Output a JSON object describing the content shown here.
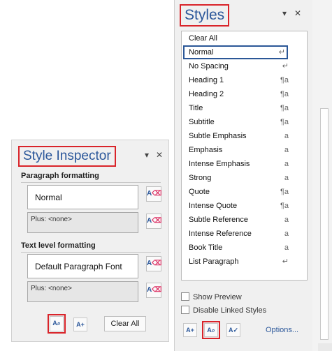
{
  "styles_pane": {
    "title": "Styles",
    "dropdown_icon": "▾",
    "close_icon": "✕",
    "items": [
      {
        "label": "Clear All",
        "icon": ""
      },
      {
        "label": "Normal",
        "icon": "↵"
      },
      {
        "label": "No Spacing",
        "icon": "↵"
      },
      {
        "label": "Heading 1",
        "icon": "¶a"
      },
      {
        "label": "Heading 2",
        "icon": "¶a"
      },
      {
        "label": "Title",
        "icon": "¶a"
      },
      {
        "label": "Subtitle",
        "icon": "¶a"
      },
      {
        "label": "Subtle Emphasis",
        "icon": "a"
      },
      {
        "label": "Emphasis",
        "icon": "a"
      },
      {
        "label": "Intense Emphasis",
        "icon": "a"
      },
      {
        "label": "Strong",
        "icon": "a"
      },
      {
        "label": "Quote",
        "icon": "¶a"
      },
      {
        "label": "Intense Quote",
        "icon": "¶a"
      },
      {
        "label": "Subtle Reference",
        "icon": "a"
      },
      {
        "label": "Intense Reference",
        "icon": "a"
      },
      {
        "label": "Book Title",
        "icon": "a"
      },
      {
        "label": "List Paragraph",
        "icon": "↵"
      }
    ],
    "selected": "Normal",
    "show_preview": "Show Preview",
    "disable_linked": "Disable Linked Styles",
    "options": "Options..."
  },
  "inspector": {
    "title": "Style Inspector",
    "dropdown_icon": "▾",
    "close_icon": "✕",
    "paragraph_label": "Paragraph formatting",
    "paragraph_value": "Normal",
    "paragraph_plus": "Plus: <none>",
    "text_label": "Text level formatting",
    "text_value": "Default Paragraph Font",
    "text_plus": "Plus: <none>",
    "clear_all": "Clear All"
  },
  "colors": {
    "accent": "#2b579a",
    "highlight": "#d9242a"
  }
}
